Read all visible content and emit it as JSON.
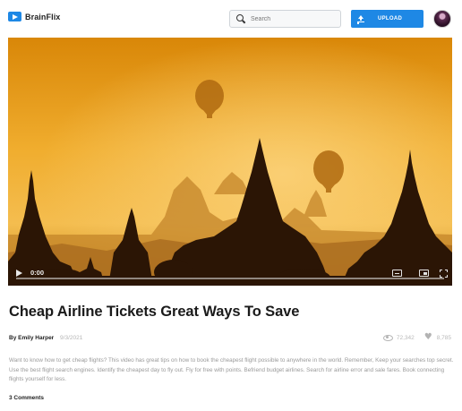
{
  "header": {
    "brand": "BrainFlix",
    "search_placeholder": "Search",
    "upload_label": "UPLOAD",
    "accent_color": "#1e88e5"
  },
  "video": {
    "current_time": "0:00",
    "progress_percent": 0,
    "icons": [
      "play-icon",
      "closed-captions-icon",
      "picture-in-picture-icon",
      "fullscreen-icon"
    ]
  },
  "details": {
    "title": "Cheap Airline Tickets Great Ways To Save",
    "author": "By Emily Harper",
    "date": "9/3/2021",
    "views": "72,342",
    "likes": "8,785",
    "description": "Want to know how to get cheap flights? This video has great tips on how to book the cheapest flight possible to anywhere in the world. Remember, Keep your searches top secret. Use the best flight search engines. Identify the cheapest day to fly out. Fly for free with points. Befriend budget airlines. Search for airline error and sale fares. Book connecting flights yourself for less.",
    "comments_count": "3 Comments"
  }
}
